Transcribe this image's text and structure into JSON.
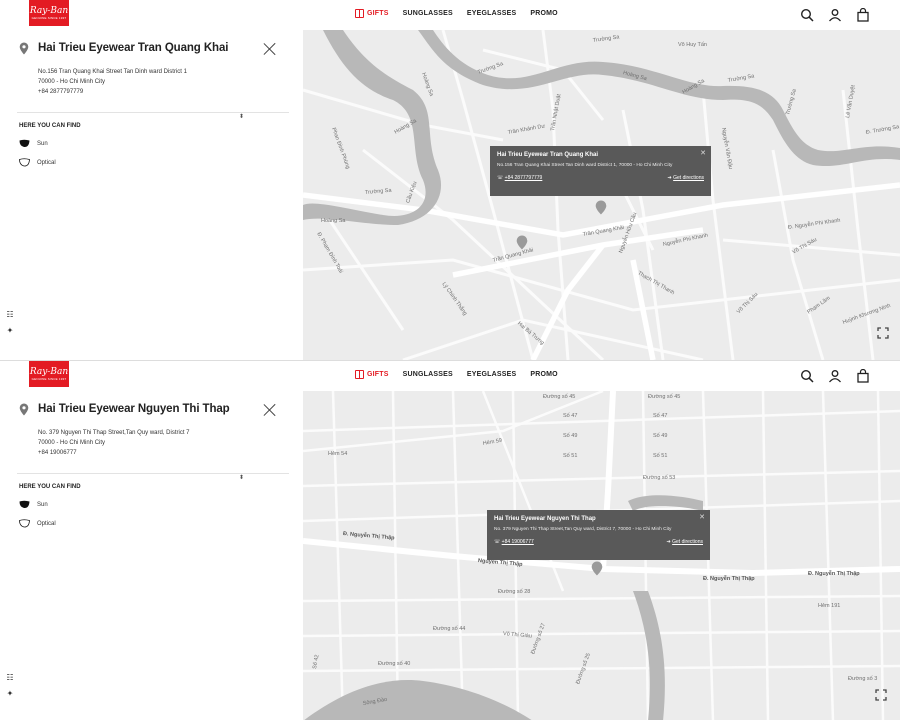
{
  "header": {
    "brand": "Ray-Ban",
    "brand_tagline": "GENUINE SINCE 1937",
    "nav": [
      "GIFTS",
      "SUNGLASSES",
      "EYEGLASSES",
      "PROMO"
    ]
  },
  "stores": [
    {
      "name": "Hai Trieu Eyewear Tran Quang Khai",
      "address_lines": [
        "No.156 Tran Quang Khai Street Tan Dinh ward District 1",
        "70000 - Ho Chi Minh City",
        "+84 2877797779"
      ],
      "here_you_can_find": "HERE YOU CAN FIND",
      "categories": [
        "Sun",
        "Optical"
      ],
      "popup": {
        "title": "Hai Trieu Eyewear Tran Quang Khai",
        "address": "No.156 Tran Quang Khai Street Tan Dinh ward District 1, 70000 - Ho Chi Minh City",
        "phone": "+84 2877797779",
        "directions": "Get directions"
      },
      "map_labels": [
        "Trường Sa",
        "Trường Sa",
        "Trường Sa",
        "Hoàng Sa",
        "Hoàng Sa",
        "Hoàng Sa",
        "Trường Sa",
        "Võ Huy Tấn",
        "Lê Văn Duyệt",
        "Hoàng Sa",
        "Trần Khánh Dư",
        "Trần Nhật Duật",
        "Nguyễn Văn Đậu",
        "Trần Quang Khải",
        "Trần Quang Khải",
        "Đ. Nguyễn Phi Khanh",
        "Nguyễn Phi Khanh",
        "Võ Thị Sáu",
        "Hai Bà Trưng",
        "Lý Chính Thắng",
        "Thạch Thị Thanh",
        "Đ. Phạm Đình Toái",
        "Võ Thị Sáu",
        "Cầu Kiệu",
        "Trường Sa",
        "Đ. Trường Sa",
        "Hoàng Sa",
        "Phan Đình Phùng",
        "Nguyễn Hữu Cầu",
        "Phạm Lâm",
        "Huỳnh Khương Ninh"
      ]
    },
    {
      "name": "Hai Trieu Eyewear Nguyen Thi Thap",
      "address_lines": [
        "No. 379 Nguyen Thi Thap Street,Tan Quy ward, District 7",
        "70000 - Ho Chi Minh City",
        "+84 19006777"
      ],
      "here_you_can_find": "HERE YOU CAN FIND",
      "categories": [
        "Sun",
        "Optical"
      ],
      "popup": {
        "title": "Hai Trieu Eyewear Nguyen Thi Thap",
        "address": "No. 379 Nguyen Thi Thap Street,Tan Quy ward, District 7, 70000 - Ho Chi Minh City",
        "phone": "+84 19006777",
        "directions": "Get directions"
      },
      "map_labels": [
        "Đường số 45",
        "Đường số 45",
        "Số 47",
        "Số 47",
        "Số 49",
        "Số 49",
        "Số 51",
        "Số 51",
        "Hẻm 59",
        "Hẻm 54",
        "Đường số 53",
        "Đ. Nguyễn Thị Thập",
        "Nguyễn Thị Thập",
        "Đ. Nguyễn Thị Thập",
        "Đ. Nguyễn Thị Thập",
        "Đường số 28",
        "Đường số 44",
        "Đường số 40",
        "Võ Thị Giàu",
        "Đường số 27",
        "Đường số 25",
        "Hẻm 191",
        "Đường số 3",
        "Sông Đào",
        "Số 42"
      ]
    }
  ]
}
